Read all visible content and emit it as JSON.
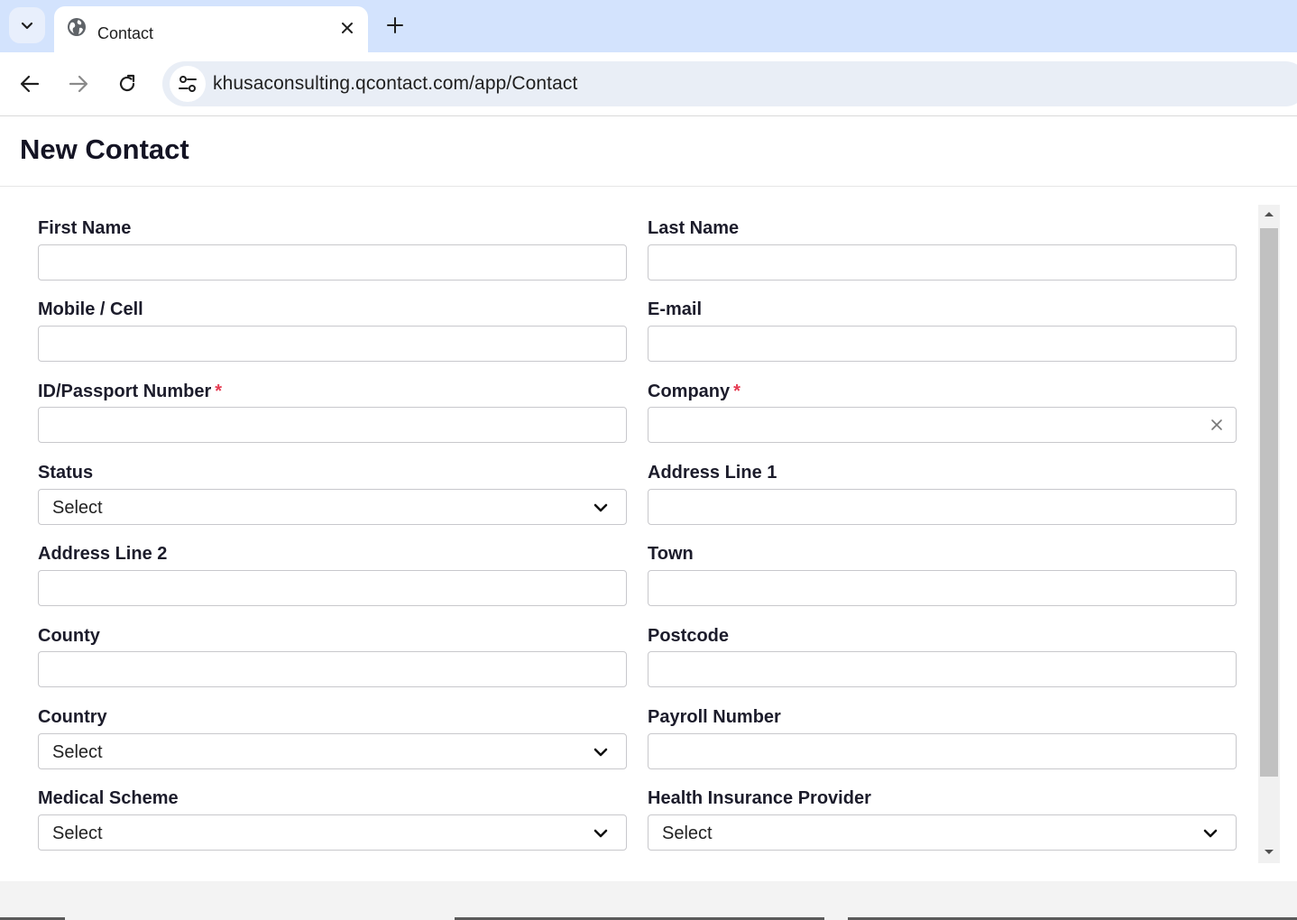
{
  "browser": {
    "tab_title": "Contact",
    "url": "khusaconsulting.qcontact.com/app/Contact"
  },
  "page": {
    "title": "New Contact"
  },
  "form": {
    "fields": [
      {
        "label": "First Name",
        "type": "text",
        "value": ""
      },
      {
        "label": "Last Name",
        "type": "text",
        "value": ""
      },
      {
        "label": "Mobile / Cell",
        "type": "text",
        "value": ""
      },
      {
        "label": "E-mail",
        "type": "text",
        "value": ""
      },
      {
        "label": "ID/Passport Number",
        "required_mark": "*",
        "type": "text",
        "value": ""
      },
      {
        "label": "Company",
        "required_mark": "*",
        "type": "lookup",
        "value": ""
      },
      {
        "label": "Status",
        "type": "select",
        "value": "Select"
      },
      {
        "label": "Address Line 1",
        "type": "text",
        "value": ""
      },
      {
        "label": "Address Line 2",
        "type": "text",
        "value": ""
      },
      {
        "label": "Town",
        "type": "text",
        "value": ""
      },
      {
        "label": "County",
        "type": "text",
        "value": ""
      },
      {
        "label": "Postcode",
        "type": "text",
        "value": ""
      },
      {
        "label": "Country",
        "type": "select",
        "value": "Select"
      },
      {
        "label": "Payroll Number",
        "type": "text",
        "value": ""
      },
      {
        "label": "Medical Scheme",
        "type": "select",
        "value": "Select"
      },
      {
        "label": "Health Insurance Provider",
        "type": "select",
        "value": "Select"
      }
    ]
  },
  "colors": {
    "accent_required": "#e53950",
    "tabbar": "#d3e3fd",
    "title_text": "#141424"
  },
  "icons": [
    "chevron-down-icon",
    "globe-icon",
    "close-icon",
    "plus-icon",
    "back-arrow-icon",
    "forward-arrow-icon",
    "reload-icon",
    "site-settings-icon",
    "clear-icon"
  ]
}
